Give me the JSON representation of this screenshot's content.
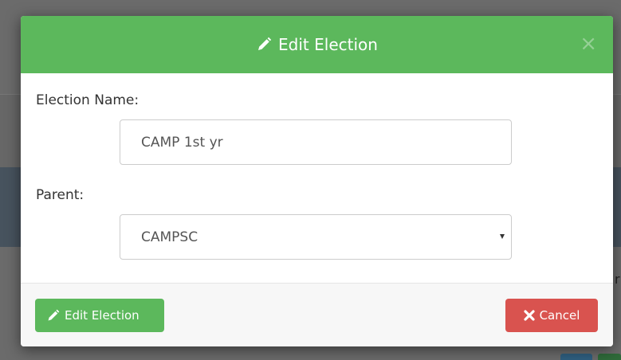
{
  "modal": {
    "title": "Edit Election",
    "close_glyph": "×",
    "fields": {
      "election_name_label": "Election Name:",
      "election_name_value": "CAMP 1st yr",
      "parent_label": "Parent:",
      "parent_value": "CAMPSC"
    },
    "footer": {
      "submit_label": "Edit Election",
      "cancel_label": "Cancel"
    }
  },
  "icons": {
    "header": "pencil-icon",
    "submit": "pencil-icon",
    "cancel": "times-icon",
    "close": "close-icon",
    "select": "caret-down-icon"
  },
  "colors": {
    "success": "#5cb85c",
    "danger": "#d9534f",
    "overlay": "#5a5a5a"
  }
}
